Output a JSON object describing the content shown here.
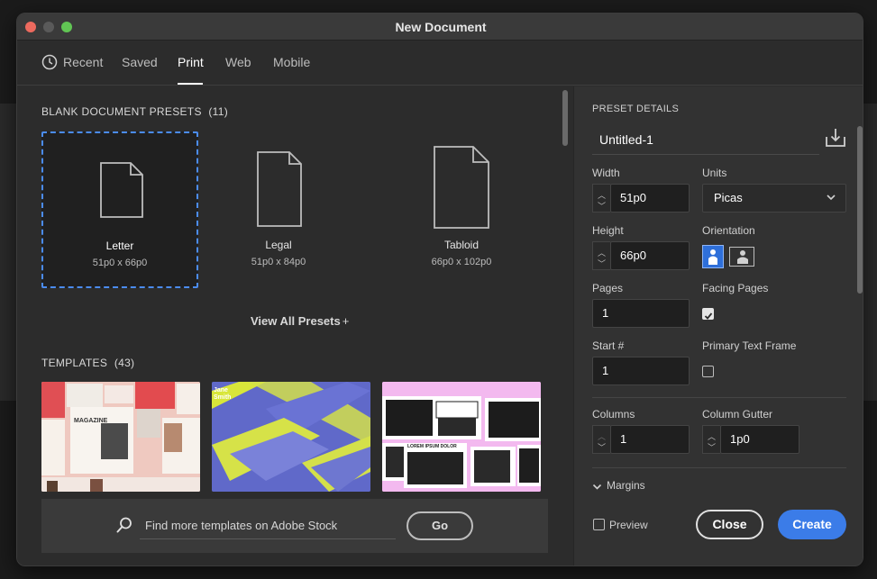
{
  "window": {
    "title": "New Document"
  },
  "tabs": [
    {
      "label": "Recent"
    },
    {
      "label": "Saved"
    },
    {
      "label": "Print"
    },
    {
      "label": "Web"
    },
    {
      "label": "Mobile"
    }
  ],
  "active_tab": "Print",
  "presets": {
    "heading": "BLANK DOCUMENT PRESETS",
    "count": "(11)",
    "items": [
      {
        "name": "Letter",
        "size": "51p0 x 66p0"
      },
      {
        "name": "Legal",
        "size": "51p0 x 84p0"
      },
      {
        "name": "Tabloid",
        "size": "66p0 x 102p0"
      }
    ],
    "view_all": "View All Presets"
  },
  "templates": {
    "heading": "TEMPLATES",
    "count": "(43)",
    "thumbs": [
      {
        "text": "MAGAZINE"
      },
      {
        "text": "Jane Smith"
      },
      {
        "text": "LOREM IPSUM DOLOR"
      }
    ]
  },
  "stock": {
    "placeholder": "Find more templates on Adobe Stock",
    "go": "Go"
  },
  "details": {
    "heading": "PRESET DETAILS",
    "name": "Untitled-1",
    "width_label": "Width",
    "width": "51p0",
    "units_label": "Units",
    "units": "Picas",
    "height_label": "Height",
    "height": "66p0",
    "orientation_label": "Orientation",
    "pages_label": "Pages",
    "pages": "1",
    "facing_label": "Facing Pages",
    "facing_checked": true,
    "start_label": "Start #",
    "start": "1",
    "ptf_label": "Primary Text Frame",
    "ptf_checked": false,
    "columns_label": "Columns",
    "columns": "1",
    "gutter_label": "Column Gutter",
    "gutter": "1p0",
    "margins": "Margins"
  },
  "footer": {
    "preview": "Preview",
    "close": "Close",
    "create": "Create"
  },
  "colors": {
    "accent": "#3b7ce8",
    "selection": "#4b8cf0"
  }
}
